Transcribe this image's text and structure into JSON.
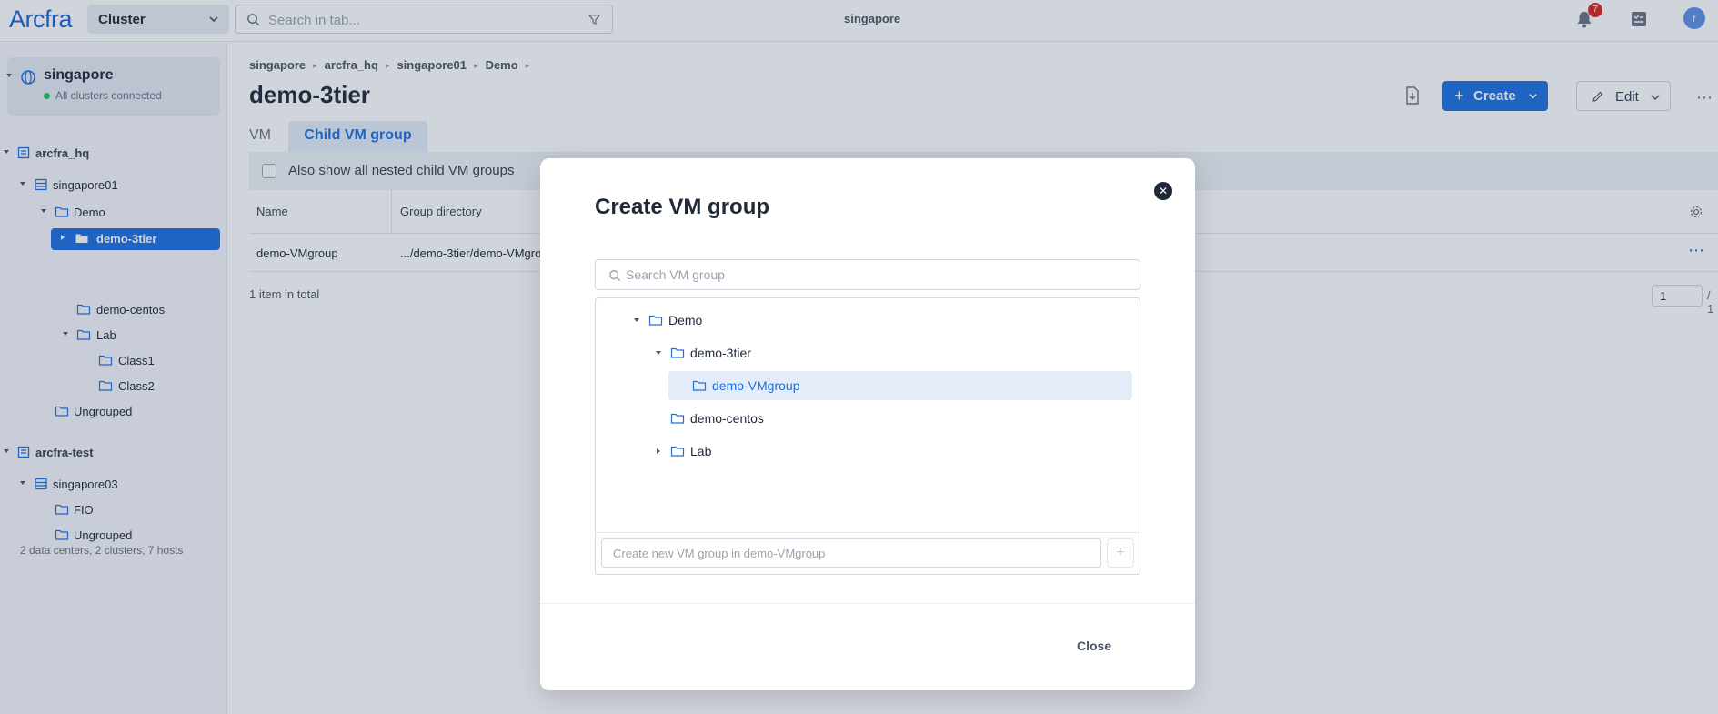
{
  "topbar": {
    "logo": "Arcfra",
    "cluster_select": "Cluster",
    "search_placeholder": "Search in tab...",
    "center_title": "singapore",
    "notifications_count": "7",
    "avatar_letter": "r"
  },
  "sidebar": {
    "datacenter": {
      "name": "singapore",
      "status": "All clusters connected",
      "status_color": "#22c55e"
    },
    "tree": {
      "arcfra_hq": "arcfra_hq",
      "singapore01": "singapore01",
      "demo": "Demo",
      "demo_3tier": "demo-3tier",
      "demo_centos": "demo-centos",
      "lab": "Lab",
      "class1": "Class1",
      "class2": "Class2",
      "ungrouped1": "Ungrouped",
      "arcfra_test": "arcfra-test",
      "singapore03": "singapore03",
      "fio": "FIO",
      "ungrouped2": "Ungrouped"
    },
    "footer": "2 data centers, 2 clusters, 7 hosts"
  },
  "main": {
    "breadcrumb": [
      "singapore",
      "arcfra_hq",
      "singapore01",
      "Demo"
    ],
    "title": "demo-3tier",
    "create_label": "Create",
    "edit_label": "Edit",
    "tabs": {
      "vm": "VM",
      "child": "Child VM group"
    },
    "nested_checkbox_label": "Also show all nested child VM groups",
    "table": {
      "headers": {
        "name": "Name",
        "directory": "Group directory"
      },
      "rows": [
        {
          "name": "demo-VMgroup",
          "directory": ".../demo-3tier/demo-VMgro"
        }
      ]
    },
    "total": "1 item in total",
    "page_value": "1",
    "page_total": "/ 1"
  },
  "modal": {
    "title": "Create VM group",
    "search_placeholder": "Search VM group",
    "tree": {
      "demo": "Demo",
      "demo_3tier": "demo-3tier",
      "demo_vmgroup": "demo-VMgroup",
      "demo_centos": "demo-centos",
      "lab": "Lab"
    },
    "new_placeholder": "Create new VM group in demo-VMgroup",
    "add_label": "+",
    "close_label": "Close"
  },
  "colors": {
    "accent": "#1d6fe0",
    "badge": "#dc2626"
  }
}
